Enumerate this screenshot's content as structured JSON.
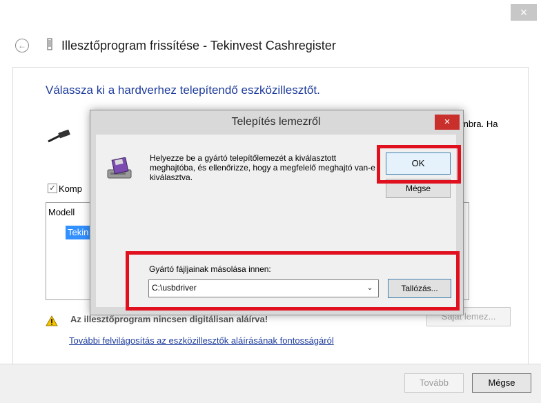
{
  "wizard": {
    "close_glyph": "×",
    "back_glyph": "←",
    "title": "Illesztőprogram frissítése - Tekinvest Cashregister",
    "instruction": "Válassza ki a hardverhez telepítendő eszközillesztőt.",
    "right_fragment": "mbra. Ha",
    "compat_check": "✓",
    "compat_label": "Komp",
    "model_header": "Modell",
    "model_row": "Tekin",
    "disk_button": "Saját lemez...",
    "warning": "Az illesztőprogram nincsen digitálisan aláírva!",
    "signing_link": "További felvilágosítás az eszközillesztők aláírásának fontosságáról",
    "next_button": "Tovább",
    "cancel_button": "Mégse",
    "icons": [
      "back-arrow-icon",
      "device-icon",
      "usb-cable-icon",
      "warning-icon"
    ]
  },
  "dialog": {
    "title": "Telepítés lemezről",
    "close_glyph": "×",
    "message": "Helyezze be a gyártó telepítőlemezét a kiválasztott meghajtóba, és ellenőrizze, hogy a megfelelő meghajtó van-e kiválasztva.",
    "ok_button": "OK",
    "cancel_button": "Mégse",
    "copy_label": "Gyártó fájljainak másolása innen:",
    "path_value": "C:\\usbdriver",
    "chevron_glyph": "⌄",
    "browse_button": "Tallózás...",
    "icons": [
      "floppy-disk-icon",
      "chevron-down-icon"
    ]
  },
  "colors": {
    "accent_text": "#1c3b9c",
    "highlight": "#e0101e",
    "dialog_close": "#c9302c",
    "selection": "#3390ff"
  }
}
